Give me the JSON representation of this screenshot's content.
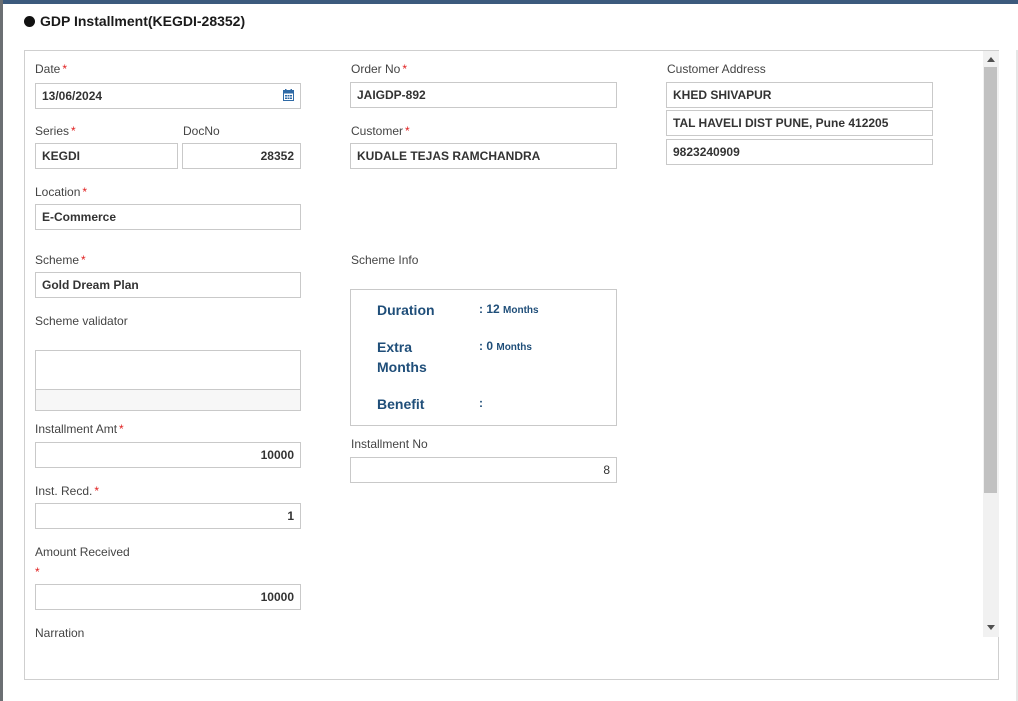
{
  "title": "GDP Installment(KEGDI-28352)",
  "form": {
    "date": {
      "label": "Date",
      "value": "13/06/2024"
    },
    "order_no": {
      "label": "Order No",
      "value": "JAIGDP-892"
    },
    "customer_address": {
      "label": "Customer Address",
      "line1": "KHED SHIVAPUR",
      "line2": "TAL HAVELI DIST PUNE, Pune 412205",
      "phone": "9823240909"
    },
    "series": {
      "label": "Series",
      "value": "KEGDI"
    },
    "doc_no": {
      "label": "DocNo",
      "value": "28352"
    },
    "customer": {
      "label": "Customer",
      "value": "KUDALE TEJAS RAMCHANDRA"
    },
    "location": {
      "label": "Location",
      "value": "E-Commerce"
    },
    "scheme": {
      "label": "Scheme",
      "value": "Gold Dream Plan"
    },
    "scheme_info": {
      "label": "Scheme Info",
      "duration_label": "Duration",
      "duration_value": ": 12",
      "duration_unit": "Months",
      "extra_label_1": "Extra",
      "extra_label_2": "Months",
      "extra_value": ": 0",
      "extra_unit": "Months",
      "benefit_label": "Benefit",
      "benefit_value": ":"
    },
    "scheme_validator": {
      "label": "Scheme validator",
      "value": ""
    },
    "installment_amt": {
      "label": "Installment Amt",
      "value": "10000"
    },
    "installment_no": {
      "label": "Installment No",
      "value": "8"
    },
    "inst_recd": {
      "label": "Inst. Recd.",
      "value": "1"
    },
    "amount_received": {
      "label": "Amount Received",
      "value": "10000"
    },
    "narration": {
      "label": "Narration"
    },
    "required_mark": "*"
  },
  "icons": {
    "calendar": "calendar-icon"
  },
  "colors": {
    "accent": "#1f4e79",
    "required": "#e02020",
    "border": "#c9c9c9"
  }
}
